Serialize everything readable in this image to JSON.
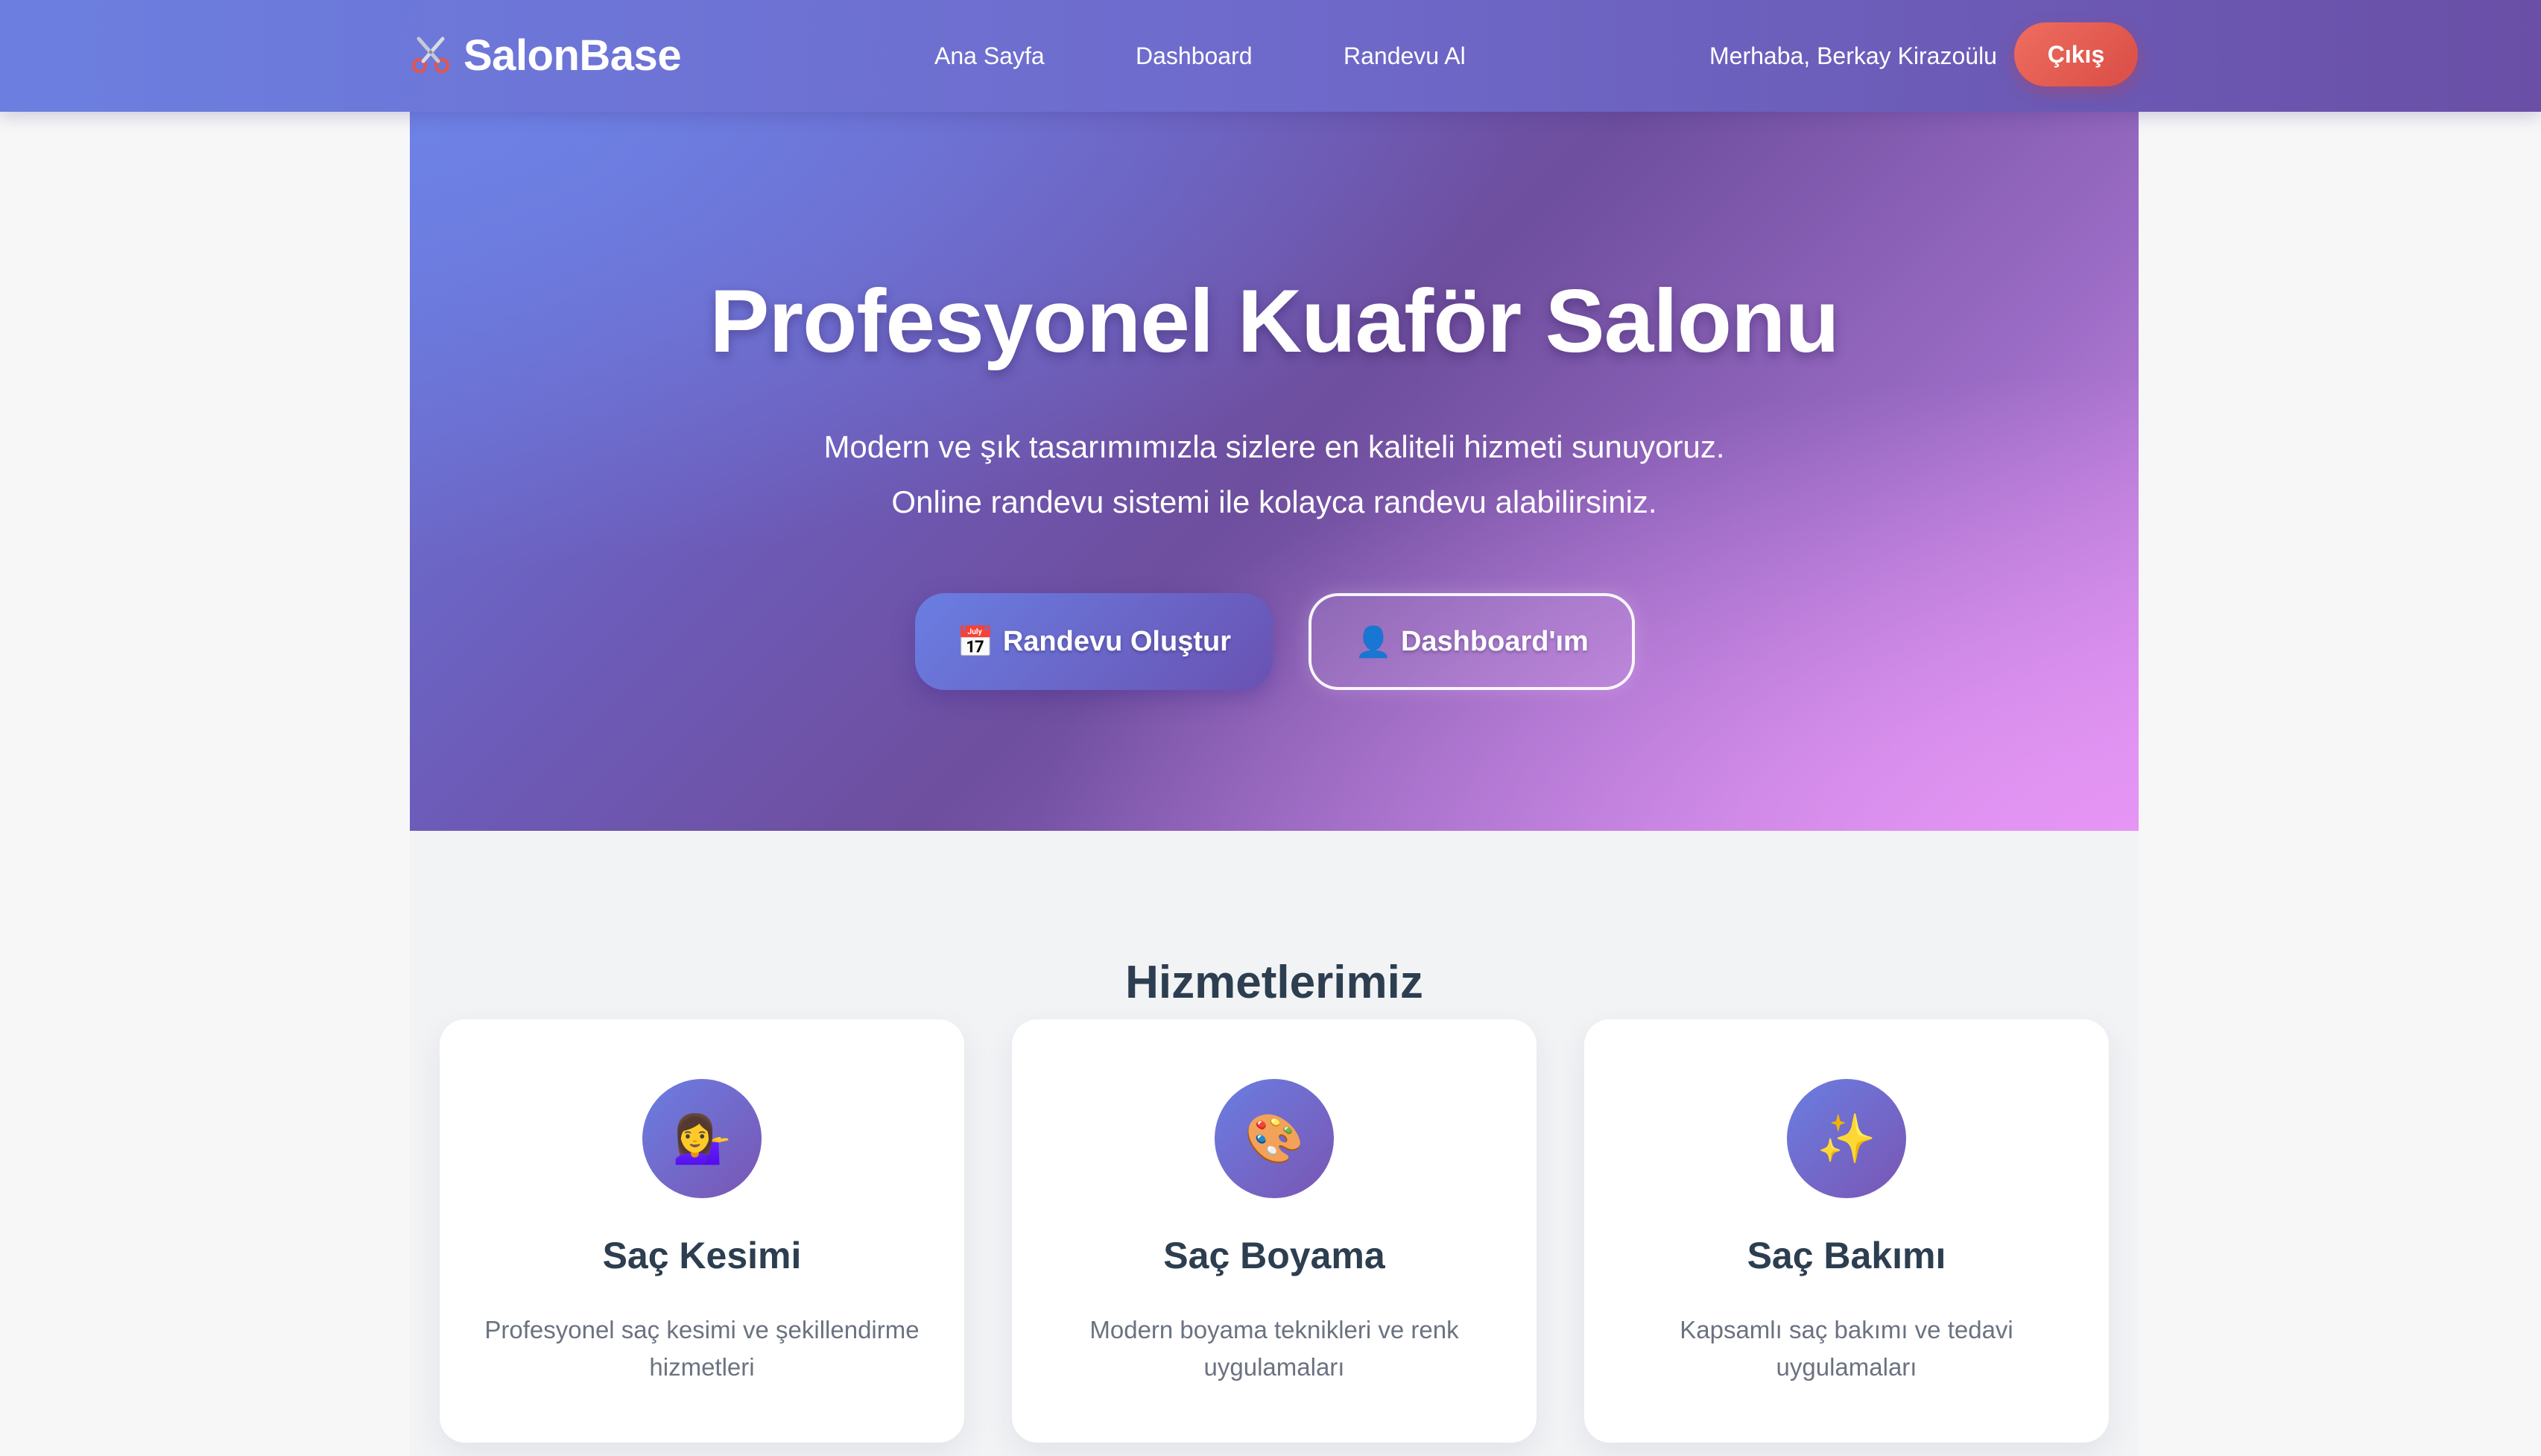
{
  "navbar": {
    "brand": {
      "icon": "scissors-icon",
      "name": "SalonBase"
    },
    "links": {
      "home": "Ana Sayfa",
      "dashboard": "Dashboard",
      "appointment": "Randevu Al"
    },
    "greeting": "Merhaba, Berkay Kirazoülu",
    "logout_label": "Çıkış"
  },
  "hero": {
    "title": "Profesyonel Kuaför Salonu",
    "subtitle_line1": "Modern ve şık tasarımımızla sizlere en kaliteli hizmeti sunuyoruz.",
    "subtitle_line2": "Online randevu sistemi ile kolayca randevu alabilirsiniz.",
    "primary_button": {
      "icon": "📅",
      "icon_name": "calendar-icon",
      "label": "Randevu Oluştur"
    },
    "secondary_button": {
      "icon": "👤",
      "icon_name": "user-icon",
      "label": "Dashboard'ım"
    }
  },
  "services": {
    "title": "Hizmetlerimiz",
    "items": [
      {
        "icon": "💁‍♀️",
        "icon_name": "woman-tipping-hand-icon",
        "title": "Saç Kesimi",
        "description": "Profesyonel saç kesimi ve şekillendirme hizmetleri"
      },
      {
        "icon": "🎨",
        "icon_name": "artist-palette-icon",
        "title": "Saç Boyama",
        "description": "Modern boyama teknikleri ve renk uygulamaları"
      },
      {
        "icon": "✨",
        "icon_name": "sparkles-icon",
        "title": "Saç Bakımı",
        "description": "Kapsamlı saç bakımı ve tedavi uygulamaları"
      }
    ]
  },
  "colors": {
    "nav_gradient_start": "#6c7fe0",
    "nav_gradient_end": "#6a4fa6",
    "logout": "#e05a50",
    "accent": "#6a7ee2",
    "accent_dark": "#7a55b3",
    "heading": "#2c3e50",
    "muted_text": "#6b7280"
  }
}
